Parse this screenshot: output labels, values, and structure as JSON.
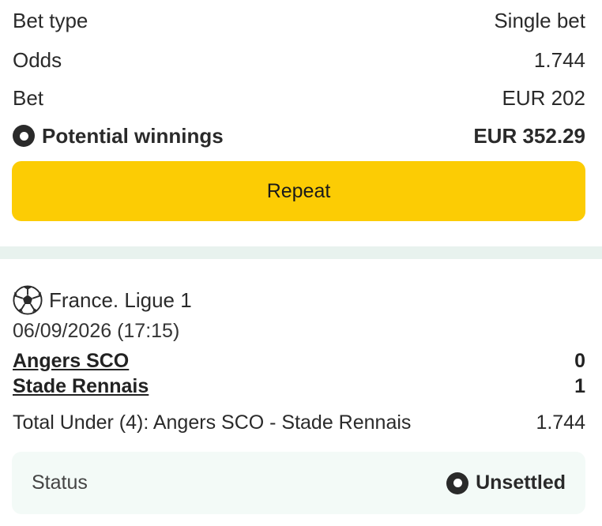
{
  "summary": {
    "bet_type_label": "Bet type",
    "bet_type_value": "Single bet",
    "odds_label": "Odds",
    "odds_value": "1.744",
    "bet_label": "Bet",
    "bet_value": "EUR 202",
    "winnings_label": "Potential winnings",
    "winnings_value": "EUR 352.29",
    "winnings_icon": "status-ring-icon"
  },
  "repeat_button": {
    "label": "Repeat",
    "color": "#fccc04"
  },
  "event": {
    "sport_icon": "soccer-ball-icon",
    "league": "France. Ligue 1",
    "date": "06/09/2026 (17:15)",
    "teams": [
      {
        "name": "Angers SCO",
        "score": "0"
      },
      {
        "name": "Stade Rennais",
        "score": "1"
      }
    ],
    "market": "Total Under (4): Angers SCO - Stade Rennais",
    "market_odds": "1.744"
  },
  "status": {
    "label": "Status",
    "value": "Unsettled",
    "icon": "status-ring-icon"
  },
  "colors": {
    "accent": "#fccc04",
    "divider": "#e8f2ee",
    "status_bg": "#f3faf7"
  }
}
